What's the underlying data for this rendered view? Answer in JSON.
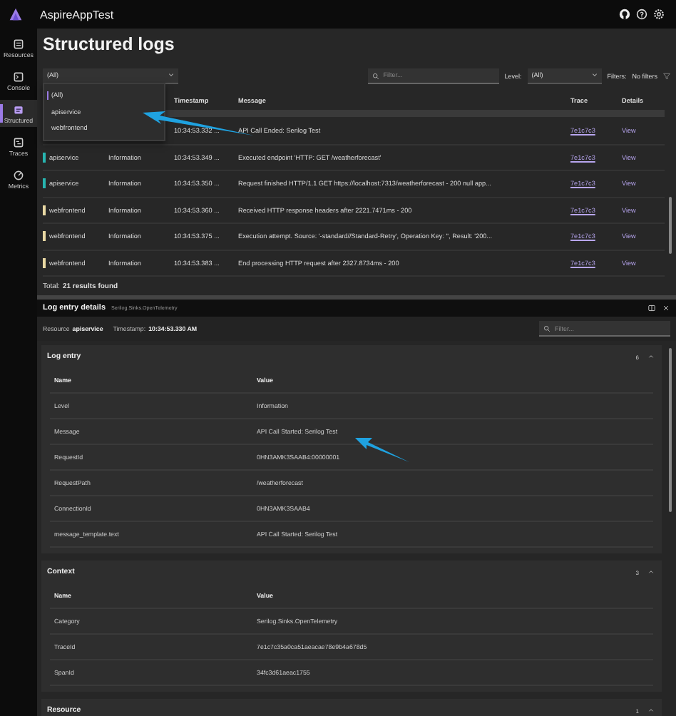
{
  "app": {
    "title": "AspireAppTest"
  },
  "sidebar": {
    "items": [
      {
        "label": "Resources",
        "selected": false
      },
      {
        "label": "Console",
        "selected": false
      },
      {
        "label": "Structured",
        "selected": true
      },
      {
        "label": "Traces",
        "selected": false
      },
      {
        "label": "Metrics",
        "selected": false
      }
    ]
  },
  "page": {
    "title": "Structured logs"
  },
  "resource_select": {
    "value": "(All)",
    "expanded": true,
    "options": [
      {
        "label": "(All)",
        "selected": true
      },
      {
        "label": "apiservice",
        "selected": false
      },
      {
        "label": "webfrontend",
        "selected": false
      }
    ]
  },
  "search": {
    "placeholder": "Filter..."
  },
  "level_filter": {
    "label": "Level:",
    "value": "(All)"
  },
  "filters": {
    "label": "Filters:",
    "value": "No filters"
  },
  "table": {
    "columns": [
      "Timestamp",
      "Message",
      "Trace",
      "Details"
    ],
    "rows": [
      {
        "timestamp": "10:34:53.332 ...",
        "message": "API Call Ended: Serilog Test",
        "trace": "7e1c7c3",
        "details": "View"
      },
      {
        "resource": "apiservice",
        "color": "#27b5b0",
        "level": "Information",
        "timestamp": "10:34:53.349 ...",
        "message": "Executed endpoint 'HTTP: GET /weatherforecast'",
        "trace": "7e1c7c3",
        "details": "View"
      },
      {
        "resource": "apiservice",
        "color": "#27b5b0",
        "level": "Information",
        "timestamp": "10:34:53.350 ...",
        "message": "Request finished HTTP/1.1 GET https://localhost:7313/weatherforecast - 200 null app...",
        "trace": "7e1c7c3",
        "details": "View"
      },
      {
        "resource": "webfrontend",
        "color": "#ead9a4",
        "level": "Information",
        "timestamp": "10:34:53.360 ...",
        "message": "Received HTTP response headers after 2221.7471ms - 200",
        "trace": "7e1c7c3",
        "details": "View"
      },
      {
        "resource": "webfrontend",
        "color": "#ead9a4",
        "level": "Information",
        "timestamp": "10:34:53.375 ...",
        "message": "Execution attempt. Source: '-standard//Standard-Retry', Operation Key: '', Result: '200...",
        "trace": "7e1c7c3",
        "details": "View"
      },
      {
        "resource": "webfrontend",
        "color": "#ead9a4",
        "level": "Information",
        "timestamp": "10:34:53.383 ...",
        "message": "End processing HTTP request after 2327.8734ms - 200",
        "trace": "7e1c7c3",
        "details": "View"
      }
    ],
    "total": "Total: **21 results found**"
  },
  "details": {
    "title": "Log entry details",
    "subtitle": "Serilog.Sinks.OpenTelemetry",
    "resource_label": "Resource",
    "resource": "apiservice",
    "timestamp_label": "Timestamp:",
    "timestamp": "10:34:53.330 AM",
    "filter": {
      "placeholder": "Filter..."
    },
    "sections": [
      {
        "title": "Log entry",
        "count": "6",
        "expanded": true,
        "columns": [
          "Name",
          "Value"
        ],
        "rows": [
          {
            "name": "Level",
            "value": "Information"
          },
          {
            "name": "Message",
            "value": "API Call Started: Serilog Test"
          },
          {
            "name": "RequestId",
            "value": "0HN3AMK3SAAB4:00000001"
          },
          {
            "name": "RequestPath",
            "value": "/weatherforecast"
          },
          {
            "name": "ConnectionId",
            "value": "0HN3AMK3SAAB4"
          },
          {
            "name": "message_template.text",
            "value": "API Call Started: Serilog Test"
          }
        ]
      },
      {
        "title": "Context",
        "count": "3",
        "expanded": true,
        "columns": [
          "Name",
          "Value"
        ],
        "rows": [
          {
            "name": "Category",
            "value": "Serilog.Sinks.OpenTelemetry"
          },
          {
            "name": "TraceId",
            "value": "7e1c7c35a0ca51aeacae78e9b4a678d5"
          },
          {
            "name": "SpanId",
            "value": "34fc3d61aeac1755"
          }
        ]
      },
      {
        "title": "Resource",
        "count": "1",
        "expanded": true
      }
    ]
  }
}
